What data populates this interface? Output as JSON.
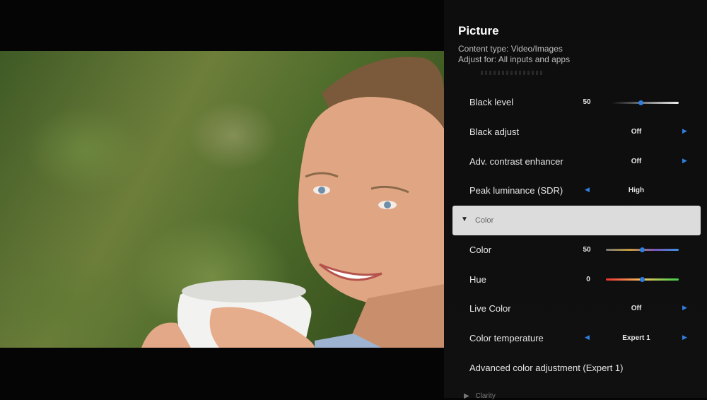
{
  "menu": {
    "title": "Picture",
    "content_type": "Content type: Video/Images",
    "adjust_for": "Adjust for: All inputs and apps"
  },
  "rows": [
    {
      "label": "Black level",
      "value": "50",
      "control": "slider",
      "level": 0.5
    },
    {
      "label": "Black adjust",
      "value": "Off",
      "control": "select"
    },
    {
      "label": "Adv. contrast enhancer",
      "value": "Off",
      "control": "select"
    },
    {
      "label": "Peak luminance (SDR)",
      "value": "High",
      "control": "select"
    }
  ],
  "color_section": {
    "header": "Color",
    "rows": [
      {
        "label": "Color",
        "value": "50",
        "control": "slider",
        "level": 0.5
      },
      {
        "label": "Hue",
        "value": "0",
        "control": "slider",
        "level": 0.5
      },
      {
        "label": "Live Color",
        "value": "Off",
        "control": "select"
      },
      {
        "label": "Color temperature",
        "value": "Expert 1",
        "control": "select"
      },
      {
        "label": "Advanced color adjustment (Expert 1)",
        "control": "link"
      }
    ]
  },
  "next_section_partial": "Clarity",
  "colors": {
    "accent": "#2f7fe0",
    "highlight": "#dcdcdc",
    "panel_bg": "#0e0e0e"
  }
}
